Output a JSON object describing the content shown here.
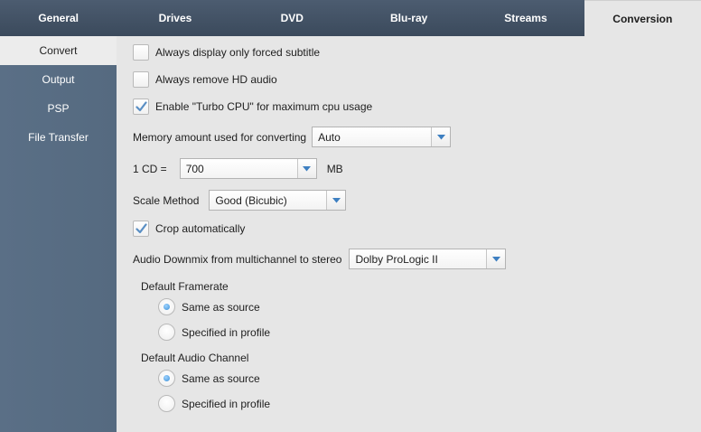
{
  "tabs": [
    {
      "label": "General",
      "active": false
    },
    {
      "label": "Drives",
      "active": false
    },
    {
      "label": "DVD",
      "active": false
    },
    {
      "label": "Blu-ray",
      "active": false
    },
    {
      "label": "Streams",
      "active": false
    },
    {
      "label": "Conversion",
      "active": true
    }
  ],
  "sidebar": {
    "items": [
      {
        "label": "Convert",
        "active": true
      },
      {
        "label": "Output",
        "active": false
      },
      {
        "label": "PSP",
        "active": false
      },
      {
        "label": "File Transfer",
        "active": false
      }
    ]
  },
  "convert": {
    "forced_subtitle": {
      "label": "Always display only forced subtitle",
      "checked": false
    },
    "remove_hd_audio": {
      "label": "Always remove HD audio",
      "checked": false
    },
    "turbo_cpu": {
      "label": "Enable \"Turbo CPU\" for maximum cpu usage",
      "checked": true
    },
    "memory": {
      "label": "Memory amount used for converting",
      "value": "Auto"
    },
    "cd": {
      "label": "1 CD =",
      "value": "700",
      "unit": "MB"
    },
    "scale": {
      "label": "Scale Method",
      "value": "Good (Bicubic)"
    },
    "crop": {
      "label": "Crop automatically",
      "checked": true
    },
    "downmix": {
      "label": "Audio Downmix from multichannel to stereo",
      "value": "Dolby ProLogic II"
    },
    "framerate": {
      "title": "Default Framerate",
      "options": [
        {
          "label": "Same as source",
          "selected": true
        },
        {
          "label": "Specified in profile",
          "selected": false
        }
      ]
    },
    "audio_channel": {
      "title": "Default Audio Channel",
      "options": [
        {
          "label": "Same as source",
          "selected": true
        },
        {
          "label": "Specified in profile",
          "selected": false
        }
      ]
    }
  },
  "colors": {
    "tabbar": "#3f4f62",
    "sidebar": "#5a6f86",
    "content_bg": "#e6e6e6",
    "check_accent": "#5a8fc4"
  }
}
